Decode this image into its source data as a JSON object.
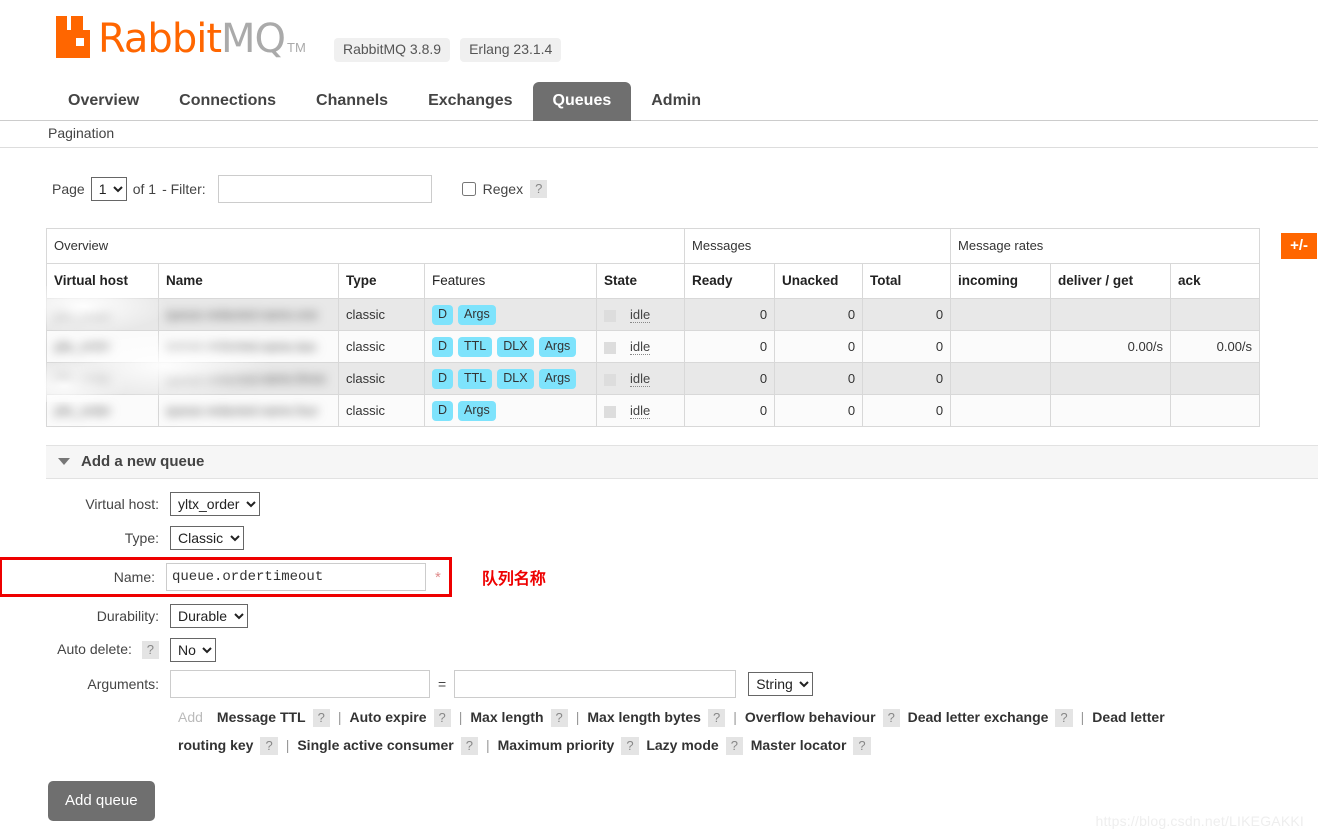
{
  "header": {
    "brand_rabbit": "Rabbit",
    "brand_mq": "MQ",
    "brand_tm": "TM",
    "badges": [
      "RabbitMQ 3.8.9",
      "Erlang 23.1.4"
    ],
    "logo_color": "#ff6600"
  },
  "nav": {
    "tabs": [
      {
        "label": "Overview",
        "active": false
      },
      {
        "label": "Connections",
        "active": false
      },
      {
        "label": "Channels",
        "active": false
      },
      {
        "label": "Exchanges",
        "active": false
      },
      {
        "label": "Queues",
        "active": true
      },
      {
        "label": "Admin",
        "active": false
      }
    ],
    "active_color": "#6f6f6f"
  },
  "pagination": {
    "title": "Pagination",
    "page_label": "Page",
    "page_value": "1",
    "page_options": [
      "1"
    ],
    "of_label": "of 1",
    "filter_label": "- Filter:",
    "filter_value": "",
    "filter_placeholder": "",
    "regex_label": "Regex",
    "regex_checked": false,
    "help": "?"
  },
  "table": {
    "group_headers": [
      {
        "label": "Overview",
        "span": 5
      },
      {
        "label": "Messages",
        "span": 3
      },
      {
        "label": "Message rates",
        "span": 3
      }
    ],
    "columns": [
      {
        "label": "Virtual host",
        "bold": true
      },
      {
        "label": "Name",
        "bold": true
      },
      {
        "label": "Type",
        "bold": true
      },
      {
        "label": "Features",
        "bold": false
      },
      {
        "label": "State",
        "bold": true
      },
      {
        "label": "Ready",
        "bold": true
      },
      {
        "label": "Unacked",
        "bold": true
      },
      {
        "label": "Total",
        "bold": true
      },
      {
        "label": "incoming",
        "bold": true
      },
      {
        "label": "deliver / get",
        "bold": true
      },
      {
        "label": "ack",
        "bold": true
      }
    ],
    "toggle_columns_label": "+/-",
    "rows": [
      {
        "vhost": "yltx_order",
        "name": "queue.redacted.name.one",
        "type": "classic",
        "features": [
          "D",
          "Args"
        ],
        "state": "idle",
        "ready": "0",
        "unacked": "0",
        "total": "0",
        "incoming": "",
        "deliver_get": "",
        "ack": "",
        "redacted": true
      },
      {
        "vhost": "yltx_order",
        "name": "queue.redacted.name.two",
        "type": "classic",
        "features": [
          "D",
          "TTL",
          "DLX",
          "Args"
        ],
        "state": "idle",
        "ready": "0",
        "unacked": "0",
        "total": "0",
        "incoming": "",
        "deliver_get": "0.00/s",
        "ack": "0.00/s",
        "redacted": true
      },
      {
        "vhost": "yltx_order",
        "name": "queue.redacted.name.three",
        "type": "classic",
        "features": [
          "D",
          "TTL",
          "DLX",
          "Args"
        ],
        "state": "idle",
        "ready": "0",
        "unacked": "0",
        "total": "0",
        "incoming": "",
        "deliver_get": "",
        "ack": "",
        "redacted": true
      },
      {
        "vhost": "yltx_order",
        "name": "queue.redacted.name.four",
        "type": "classic",
        "features": [
          "D",
          "Args"
        ],
        "state": "idle",
        "ready": "0",
        "unacked": "0",
        "total": "0",
        "incoming": "",
        "deliver_get": "",
        "ack": "",
        "redacted": true
      }
    ]
  },
  "add_queue": {
    "section_title": "Add a new queue",
    "virtual_host_label": "Virtual host:",
    "virtual_host_value": "yltx_order",
    "type_label": "Type:",
    "type_value": "Classic",
    "name_label": "Name:",
    "name_value": "queue.ordertimeout",
    "name_required_mark": "*",
    "name_annotation": "队列名称",
    "annotation_color": "#ee0000",
    "durability_label": "Durability:",
    "durability_value": "Durable",
    "auto_delete_label": "Auto delete:",
    "auto_delete_value": "No",
    "auto_delete_help": "?",
    "arguments_label": "Arguments:",
    "argument_key": "",
    "argument_value": "",
    "argument_type": "String",
    "equals": "=",
    "add_label": "Add",
    "presets": [
      {
        "label": "Message TTL",
        "help": "?",
        "separator_after": true
      },
      {
        "label": "Auto expire",
        "help": "?",
        "separator_after": true
      },
      {
        "label": "Max length",
        "help": "?",
        "separator_after": true
      },
      {
        "label": "Max length bytes",
        "help": "?",
        "separator_after": true
      },
      {
        "label": "Overflow behaviour",
        "help": "?",
        "separator_after": false
      },
      {
        "label": "Dead letter exchange",
        "help": "?",
        "separator_after": true
      },
      {
        "label": "Dead letter routing key",
        "help": "?",
        "separator_after": true
      },
      {
        "label": "Single active consumer",
        "help": "?",
        "separator_after": true
      },
      {
        "label": "Maximum priority",
        "help": "?",
        "separator_after": false
      },
      {
        "label": "Lazy mode",
        "help": "?",
        "separator_after": false
      },
      {
        "label": "Master locator",
        "help": "?",
        "separator_after": false
      }
    ],
    "submit_label": "Add queue"
  },
  "watermark": "https://blog.csdn.net/LIKEGAKKI"
}
